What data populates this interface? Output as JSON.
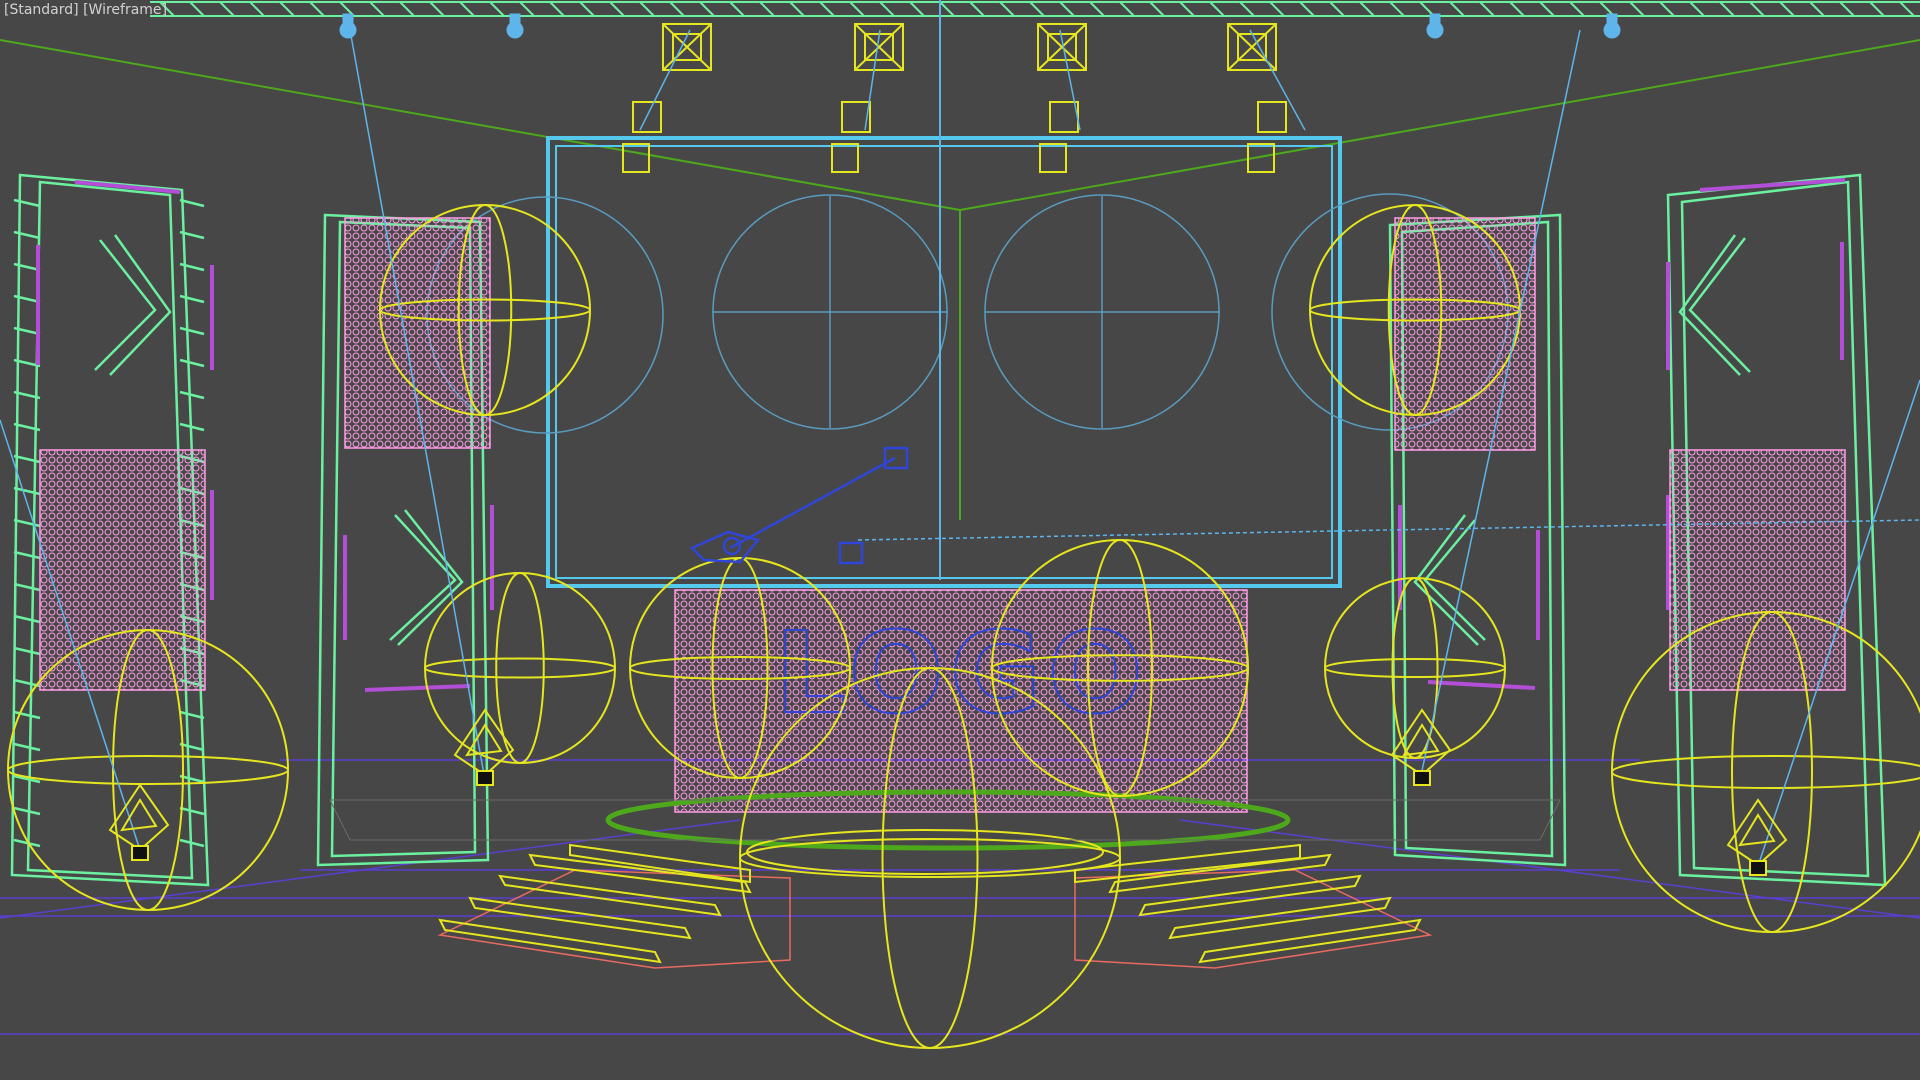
{
  "viewport": {
    "label_open": "[",
    "view_name": "Standard",
    "label_mid": "] [",
    "shading_mode": "Wireframe",
    "label_close": "]"
  },
  "scene": {
    "screen_logo_text": "LOGO"
  },
  "colors": {
    "background": "#474747",
    "truss": "#6bf0a0",
    "speaker_panel": "#ff9be6",
    "accent_purple": "#b34fd6",
    "light_gizmo": "#e6e61f",
    "screen_frame": "#55c8ee",
    "light_target": "#5fb4ea",
    "floor_ring": "#4ea81c",
    "stairs_outline": "#e86a60",
    "selected_light": "#2f46d8",
    "horizon_lines": "#5b3fd0"
  }
}
